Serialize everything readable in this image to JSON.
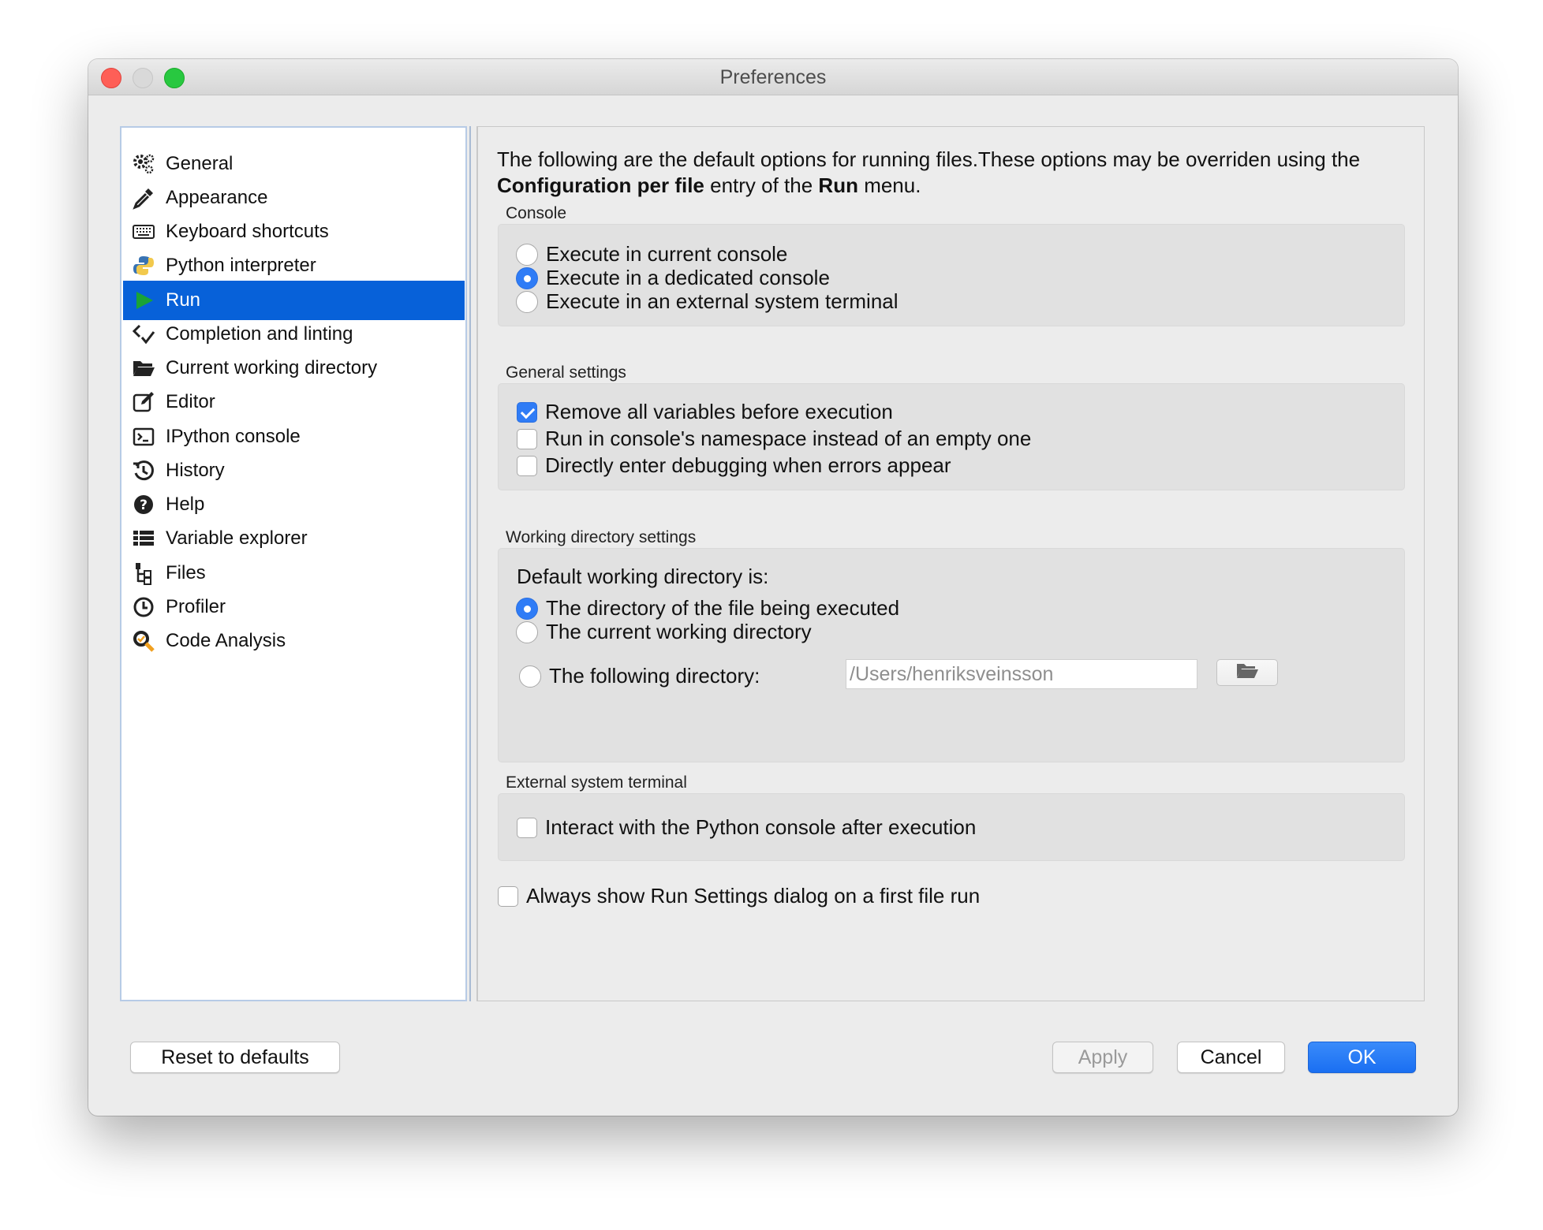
{
  "window": {
    "title": "Preferences"
  },
  "sidebar": {
    "items": [
      {
        "label": "General",
        "icon": "gears-icon"
      },
      {
        "label": "Appearance",
        "icon": "eyedropper-icon"
      },
      {
        "label": "Keyboard shortcuts",
        "icon": "keyboard-icon"
      },
      {
        "label": "Python interpreter",
        "icon": "python-icon"
      },
      {
        "label": "Run",
        "icon": "play-icon",
        "selected": true
      },
      {
        "label": "Completion and linting",
        "icon": "code-check-icon"
      },
      {
        "label": "Current working directory",
        "icon": "folder-open-icon"
      },
      {
        "label": "Editor",
        "icon": "edit-icon"
      },
      {
        "label": "IPython console",
        "icon": "terminal-icon"
      },
      {
        "label": "History",
        "icon": "history-icon"
      },
      {
        "label": "Help",
        "icon": "question-circle-icon"
      },
      {
        "label": "Variable explorer",
        "icon": "table-list-icon"
      },
      {
        "label": "Files",
        "icon": "file-tree-icon"
      },
      {
        "label": "Profiler",
        "icon": "clock-icon"
      },
      {
        "label": "Code Analysis",
        "icon": "magnifier-icon"
      }
    ]
  },
  "intro": {
    "part1": "The following are the default options for running files.These options may be overriden using the ",
    "bold1": "Configuration per file",
    "part2": " entry of the ",
    "bold2": "Run",
    "part3": " menu."
  },
  "console": {
    "title": "Console",
    "options": [
      {
        "label": "Execute in current console",
        "checked": false
      },
      {
        "label": "Execute in a dedicated console",
        "checked": true
      },
      {
        "label": "Execute in an external system terminal",
        "checked": false
      }
    ]
  },
  "general": {
    "title": "General settings",
    "options": [
      {
        "label": "Remove all variables before execution",
        "checked": true
      },
      {
        "label": "Run in console's namespace instead of an empty one",
        "checked": false
      },
      {
        "label": "Directly enter debugging when errors appear",
        "checked": false
      }
    ]
  },
  "workdir": {
    "title": "Working directory settings",
    "heading": "Default working directory is:",
    "options": [
      {
        "label": "The directory of the file being executed",
        "checked": true
      },
      {
        "label": "The current working directory",
        "checked": false
      },
      {
        "label": "The following directory:",
        "checked": false
      }
    ],
    "path_placeholder": "/Users/henriksveinsson"
  },
  "external": {
    "title": "External system terminal",
    "interact_label": "Interact with the Python console after execution",
    "interact_checked": false
  },
  "always_show": {
    "label": "Always show Run Settings dialog on a first file run",
    "checked": false
  },
  "buttons": {
    "reset": "Reset to defaults",
    "apply": "Apply",
    "cancel": "Cancel",
    "ok": "OK"
  },
  "colors": {
    "accent": "#0761d9",
    "selection": "#0761d9",
    "check_blue": "#2f7cf6"
  }
}
